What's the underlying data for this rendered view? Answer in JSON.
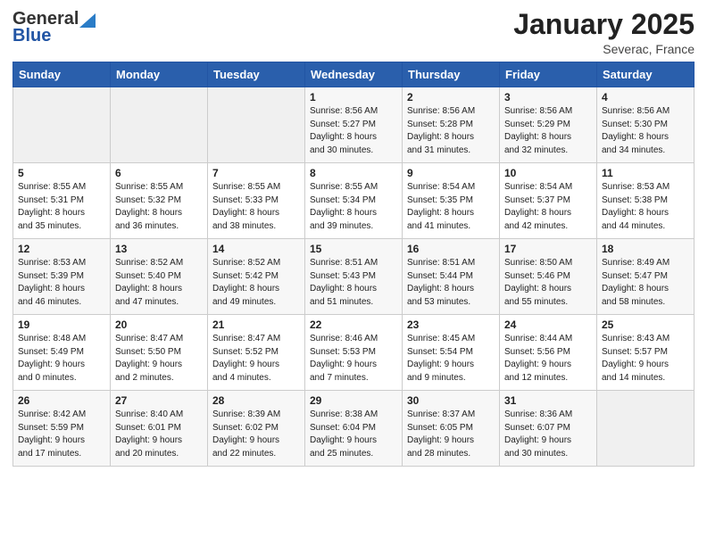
{
  "header": {
    "logo_general": "General",
    "logo_blue": "Blue",
    "month_title": "January 2025",
    "location": "Severac, France"
  },
  "days_of_week": [
    "Sunday",
    "Monday",
    "Tuesday",
    "Wednesday",
    "Thursday",
    "Friday",
    "Saturday"
  ],
  "weeks": [
    [
      {
        "day": "",
        "info": ""
      },
      {
        "day": "",
        "info": ""
      },
      {
        "day": "",
        "info": ""
      },
      {
        "day": "1",
        "info": "Sunrise: 8:56 AM\nSunset: 5:27 PM\nDaylight: 8 hours\nand 30 minutes."
      },
      {
        "day": "2",
        "info": "Sunrise: 8:56 AM\nSunset: 5:28 PM\nDaylight: 8 hours\nand 31 minutes."
      },
      {
        "day": "3",
        "info": "Sunrise: 8:56 AM\nSunset: 5:29 PM\nDaylight: 8 hours\nand 32 minutes."
      },
      {
        "day": "4",
        "info": "Sunrise: 8:56 AM\nSunset: 5:30 PM\nDaylight: 8 hours\nand 34 minutes."
      }
    ],
    [
      {
        "day": "5",
        "info": "Sunrise: 8:55 AM\nSunset: 5:31 PM\nDaylight: 8 hours\nand 35 minutes."
      },
      {
        "day": "6",
        "info": "Sunrise: 8:55 AM\nSunset: 5:32 PM\nDaylight: 8 hours\nand 36 minutes."
      },
      {
        "day": "7",
        "info": "Sunrise: 8:55 AM\nSunset: 5:33 PM\nDaylight: 8 hours\nand 38 minutes."
      },
      {
        "day": "8",
        "info": "Sunrise: 8:55 AM\nSunset: 5:34 PM\nDaylight: 8 hours\nand 39 minutes."
      },
      {
        "day": "9",
        "info": "Sunrise: 8:54 AM\nSunset: 5:35 PM\nDaylight: 8 hours\nand 41 minutes."
      },
      {
        "day": "10",
        "info": "Sunrise: 8:54 AM\nSunset: 5:37 PM\nDaylight: 8 hours\nand 42 minutes."
      },
      {
        "day": "11",
        "info": "Sunrise: 8:53 AM\nSunset: 5:38 PM\nDaylight: 8 hours\nand 44 minutes."
      }
    ],
    [
      {
        "day": "12",
        "info": "Sunrise: 8:53 AM\nSunset: 5:39 PM\nDaylight: 8 hours\nand 46 minutes."
      },
      {
        "day": "13",
        "info": "Sunrise: 8:52 AM\nSunset: 5:40 PM\nDaylight: 8 hours\nand 47 minutes."
      },
      {
        "day": "14",
        "info": "Sunrise: 8:52 AM\nSunset: 5:42 PM\nDaylight: 8 hours\nand 49 minutes."
      },
      {
        "day": "15",
        "info": "Sunrise: 8:51 AM\nSunset: 5:43 PM\nDaylight: 8 hours\nand 51 minutes."
      },
      {
        "day": "16",
        "info": "Sunrise: 8:51 AM\nSunset: 5:44 PM\nDaylight: 8 hours\nand 53 minutes."
      },
      {
        "day": "17",
        "info": "Sunrise: 8:50 AM\nSunset: 5:46 PM\nDaylight: 8 hours\nand 55 minutes."
      },
      {
        "day": "18",
        "info": "Sunrise: 8:49 AM\nSunset: 5:47 PM\nDaylight: 8 hours\nand 58 minutes."
      }
    ],
    [
      {
        "day": "19",
        "info": "Sunrise: 8:48 AM\nSunset: 5:49 PM\nDaylight: 9 hours\nand 0 minutes."
      },
      {
        "day": "20",
        "info": "Sunrise: 8:47 AM\nSunset: 5:50 PM\nDaylight: 9 hours\nand 2 minutes."
      },
      {
        "day": "21",
        "info": "Sunrise: 8:47 AM\nSunset: 5:52 PM\nDaylight: 9 hours\nand 4 minutes."
      },
      {
        "day": "22",
        "info": "Sunrise: 8:46 AM\nSunset: 5:53 PM\nDaylight: 9 hours\nand 7 minutes."
      },
      {
        "day": "23",
        "info": "Sunrise: 8:45 AM\nSunset: 5:54 PM\nDaylight: 9 hours\nand 9 minutes."
      },
      {
        "day": "24",
        "info": "Sunrise: 8:44 AM\nSunset: 5:56 PM\nDaylight: 9 hours\nand 12 minutes."
      },
      {
        "day": "25",
        "info": "Sunrise: 8:43 AM\nSunset: 5:57 PM\nDaylight: 9 hours\nand 14 minutes."
      }
    ],
    [
      {
        "day": "26",
        "info": "Sunrise: 8:42 AM\nSunset: 5:59 PM\nDaylight: 9 hours\nand 17 minutes."
      },
      {
        "day": "27",
        "info": "Sunrise: 8:40 AM\nSunset: 6:01 PM\nDaylight: 9 hours\nand 20 minutes."
      },
      {
        "day": "28",
        "info": "Sunrise: 8:39 AM\nSunset: 6:02 PM\nDaylight: 9 hours\nand 22 minutes."
      },
      {
        "day": "29",
        "info": "Sunrise: 8:38 AM\nSunset: 6:04 PM\nDaylight: 9 hours\nand 25 minutes."
      },
      {
        "day": "30",
        "info": "Sunrise: 8:37 AM\nSunset: 6:05 PM\nDaylight: 9 hours\nand 28 minutes."
      },
      {
        "day": "31",
        "info": "Sunrise: 8:36 AM\nSunset: 6:07 PM\nDaylight: 9 hours\nand 30 minutes."
      },
      {
        "day": "",
        "info": ""
      }
    ]
  ]
}
